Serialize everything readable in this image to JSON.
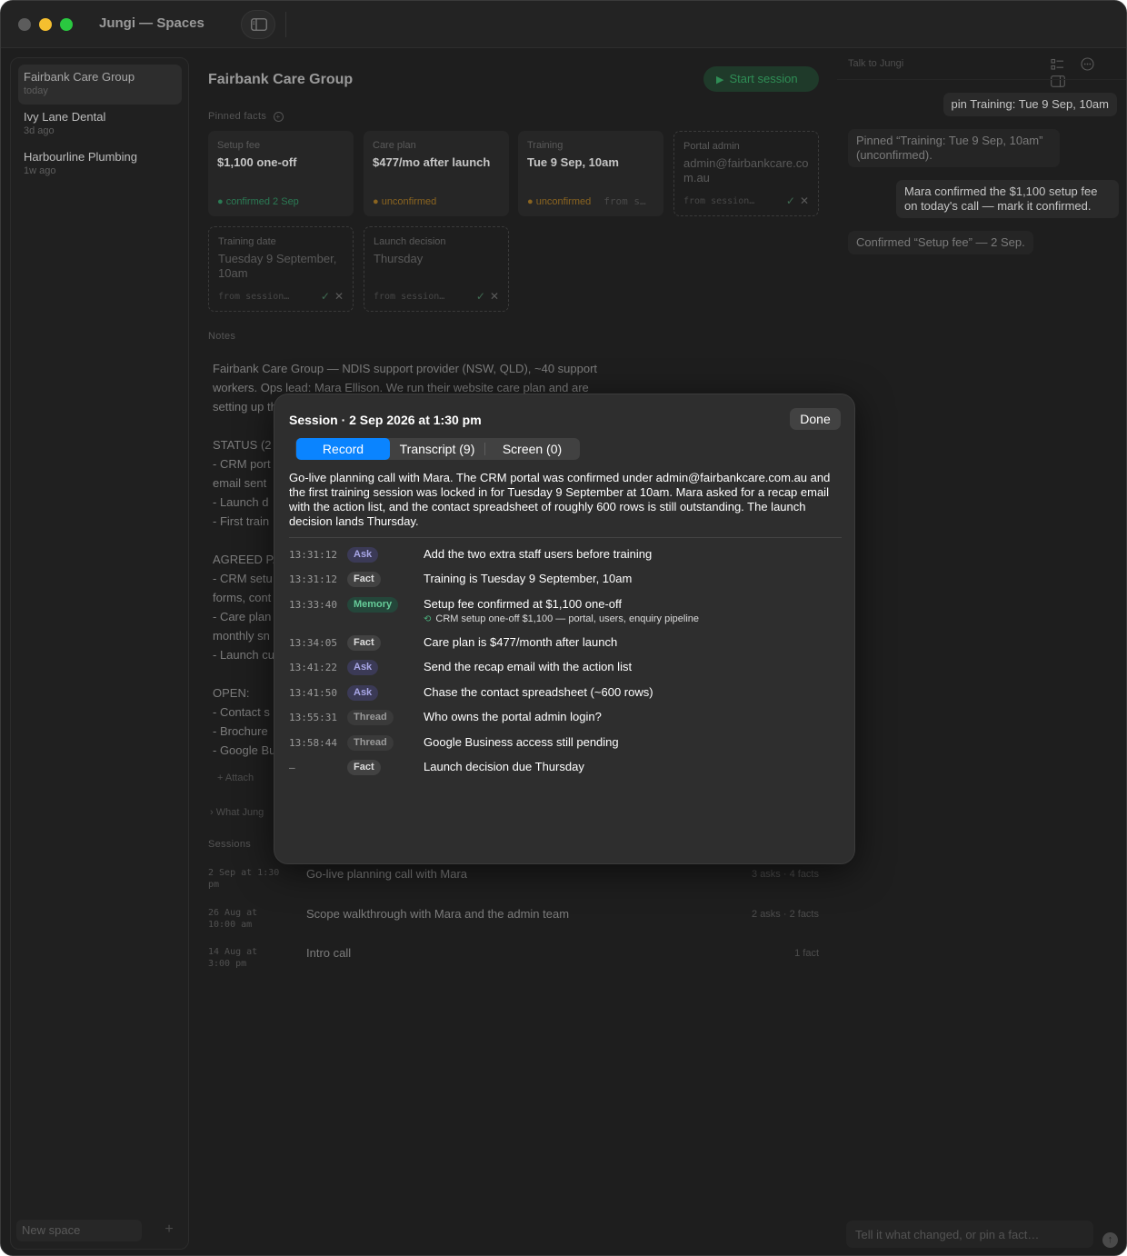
{
  "window": {
    "title": "Jungi — Spaces"
  },
  "sidebar": {
    "items": [
      {
        "name": "Fairbank Care Group",
        "time": "today"
      },
      {
        "name": "Ivy Lane Dental",
        "time": "3d ago"
      },
      {
        "name": "Harbourline Plumbing",
        "time": "1w ago"
      }
    ],
    "new_space": "New space",
    "new_plus": "+"
  },
  "main": {
    "title": "Fairbank Care Group",
    "start_button": "Start session",
    "pinned_label": "Pinned facts",
    "pinned": [
      {
        "label": "Setup fee",
        "value": "$1,100 one-off",
        "status": "● confirmed 2 Sep"
      },
      {
        "label": "Care plan",
        "value": "$477/mo after launch",
        "status": "● unconfirmed"
      },
      {
        "label": "Training",
        "value": "Tue 9 Sep, 10am",
        "status": "● unconfirmed",
        "source": "from s…"
      },
      {
        "label": "Portal admin",
        "value": "admin@fairbankcare.com.au",
        "source": "from session…"
      },
      {
        "label": "Training date",
        "value": "Tuesday 9 September, 10am",
        "source": "from session…"
      },
      {
        "label": "Launch decision",
        "value": "Thursday",
        "source": "from session…"
      }
    ],
    "notes_label": "Notes",
    "notes_lines": [
      "Fairbank Care Group — NDIS support provider (NSW, QLD), ~40 support",
      "workers. Ops lead: Mara Ellison. We run their website care plan and are",
      "setting up th",
      "",
      "STATUS (2",
      "- CRM port",
      "email sent",
      "- Launch d",
      "- First train",
      "",
      "AGREED PA",
      "- CRM setu",
      "forms, cont",
      "- Care plan",
      "monthly sn",
      "- Launch cu",
      "",
      "OPEN:",
      "- Contact s",
      "- Brochure",
      "- Google Bu"
    ],
    "attach": "+ Attach",
    "what_jungi": "› What Jung",
    "sessions_label": "Sessions",
    "sessions": [
      {
        "date": "2 Sep at 1:30 pm",
        "title": "Go-live planning call with Mara",
        "meta": "3 asks · 4 facts"
      },
      {
        "date": "26 Aug at 10:00 am",
        "title": "Scope walkthrough with Mara and the admin team",
        "meta": "2 asks · 2 facts"
      },
      {
        "date": "14 Aug at 3:00 pm",
        "title": "Intro call",
        "meta": "1 fact"
      }
    ]
  },
  "chat": {
    "header": "Talk to Jungi",
    "messages": [
      {
        "role": "user",
        "text": "pin Training: Tue 9 Sep, 10am"
      },
      {
        "role": "system",
        "text": "Pinned “Training: Tue 9 Sep, 10am” (unconfirmed)."
      },
      {
        "role": "user",
        "text": "Mara confirmed the $1,100 setup fee on today's call — mark it confirmed."
      },
      {
        "role": "system",
        "text": "Confirmed “Setup fee” — 2 Sep."
      }
    ],
    "input_placeholder": "Tell it what changed, or pin a fact…",
    "send": "↑"
  },
  "modal": {
    "title": "Session · 2 Sep 2026 at 1:30 pm",
    "done": "Done",
    "tabs": [
      "Record",
      "Transcript (9)",
      "Screen (0)"
    ],
    "active_tab": "Record",
    "summary": "Go-live planning call with Mara. The CRM portal was confirmed under admin@fairbankcare.com.au and the first training session was locked in for Tuesday 9 September at 10am. Mara asked for a recap email with the action list, and the contact spreadsheet of roughly 600 rows is still outstanding. The launch decision lands Thursday.",
    "events": [
      {
        "time": "13:31:12",
        "tag": "Ask",
        "text": "Add the two extra staff users before training"
      },
      {
        "time": "13:31:12",
        "tag": "Fact",
        "text": "Training is Tuesday 9 September, 10am"
      },
      {
        "time": "13:33:40",
        "tag": "Memory",
        "text": "Setup fee confirmed at $1,100 one-off",
        "sub": "CRM setup one-off $1,100 — portal, users, enquiry pipeline"
      },
      {
        "time": "13:34:05",
        "tag": "Fact",
        "text": "Care plan is $477/month after launch"
      },
      {
        "time": "13:41:22",
        "tag": "Ask",
        "text": "Send the recap email with the action list"
      },
      {
        "time": "13:41:50",
        "tag": "Ask",
        "text": "Chase the contact spreadsheet (~600 rows)"
      },
      {
        "time": "13:55:31",
        "tag": "Thread",
        "text": "Who owns the portal admin login?"
      },
      {
        "time": "13:58:44",
        "tag": "Thread",
        "text": "Google Business access still pending"
      },
      {
        "time": "–",
        "tag": "Fact",
        "text": "Launch decision due Thursday"
      }
    ]
  },
  "colors": {
    "accent": "#0a84ff",
    "confirmed": "#2b7a54",
    "unconfirmed": "#8a6420",
    "start_session": "#2f8d55"
  }
}
